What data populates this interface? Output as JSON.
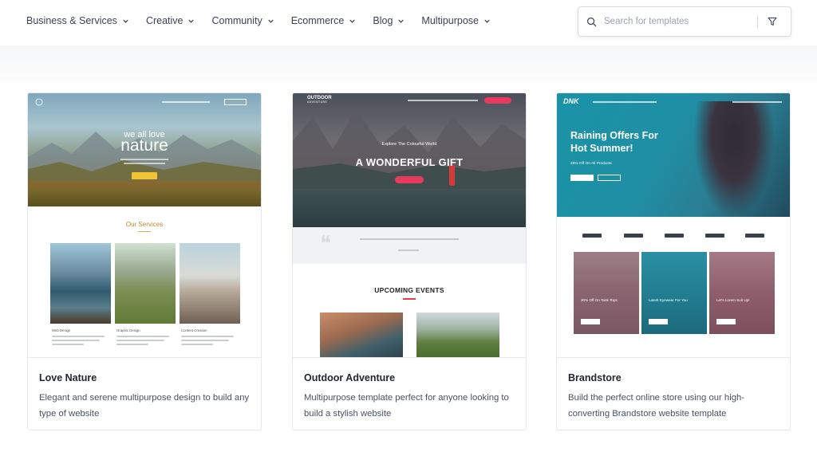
{
  "nav": {
    "items": [
      {
        "label": "Business & Services"
      },
      {
        "label": "Creative"
      },
      {
        "label": "Community"
      },
      {
        "label": "Ecommerce"
      },
      {
        "label": "Blog"
      },
      {
        "label": "Multipurpose"
      }
    ]
  },
  "search": {
    "placeholder": "Search for templates"
  },
  "cards": [
    {
      "title": "Love Nature",
      "description": "Elegant and serene multipurpose design to build any type of website",
      "thumb": {
        "hero_small": "we all love",
        "hero_big": "nature",
        "section_title": "Our Services",
        "captions": [
          "Web Design",
          "Graphic Design",
          "Content Creation"
        ]
      }
    },
    {
      "title": "Outdoor Adventure",
      "description": "Multipurpose template perfect for anyone looking to build a stylish website",
      "thumb": {
        "logo_line1": "OUTDOOR",
        "logo_line2": "ADVENTURE",
        "hero_small": "Explore The Colourful World",
        "hero_big": "A WONDERFUL GIFT",
        "section_title": "UPCOMING EVENTS"
      }
    },
    {
      "title": "Brandstore",
      "description": "Build the perfect online store using our high-converting Brandstore website template",
      "thumb": {
        "logo": "DNK",
        "hero_line1": "Raining Offers For",
        "hero_line2": "Hot Summer!",
        "hero_sub": "25% Off On All Products",
        "tiles": [
          "20% Off On Tank Tops",
          "Latest Eyewear For You",
          "Let's Lorem Suit Up!"
        ]
      }
    }
  ],
  "colors": {
    "accent_yellow": "#f1c232",
    "accent_pink": "#e83a5e",
    "brand_teal": "#1a93a7"
  }
}
